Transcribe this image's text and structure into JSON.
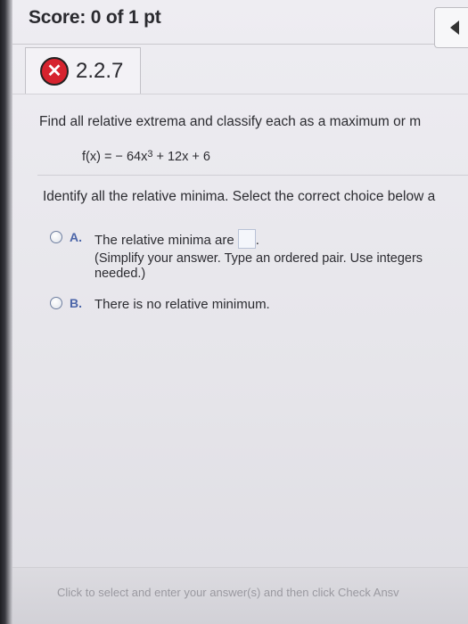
{
  "score": {
    "label": "Score: 0 of 1 pt"
  },
  "question": {
    "number": "2.2.7",
    "status_icon": "x-icon",
    "prompt": "Find all relative extrema and classify each as a maximum or m",
    "function": {
      "lhs": "f(x) = − 64x",
      "exponent": "3",
      "rhs": " + 12x + 6"
    },
    "instruction": "Identify all the relative minima. Select the correct choice below a"
  },
  "choices": [
    {
      "letter": "A.",
      "text": "The relative minima are",
      "after_box": ".",
      "hint_line1": "(Simplify your answer. Type an ordered pair. Use integers",
      "hint_line2": "needed.)"
    },
    {
      "letter": "B.",
      "text": "There is no relative minimum."
    }
  ],
  "footer": {
    "text": "Click to select and enter your answer(s) and then click Check Ansv"
  },
  "colors": {
    "error_red": "#d6232e",
    "choice_letter": "#4a64a8"
  }
}
